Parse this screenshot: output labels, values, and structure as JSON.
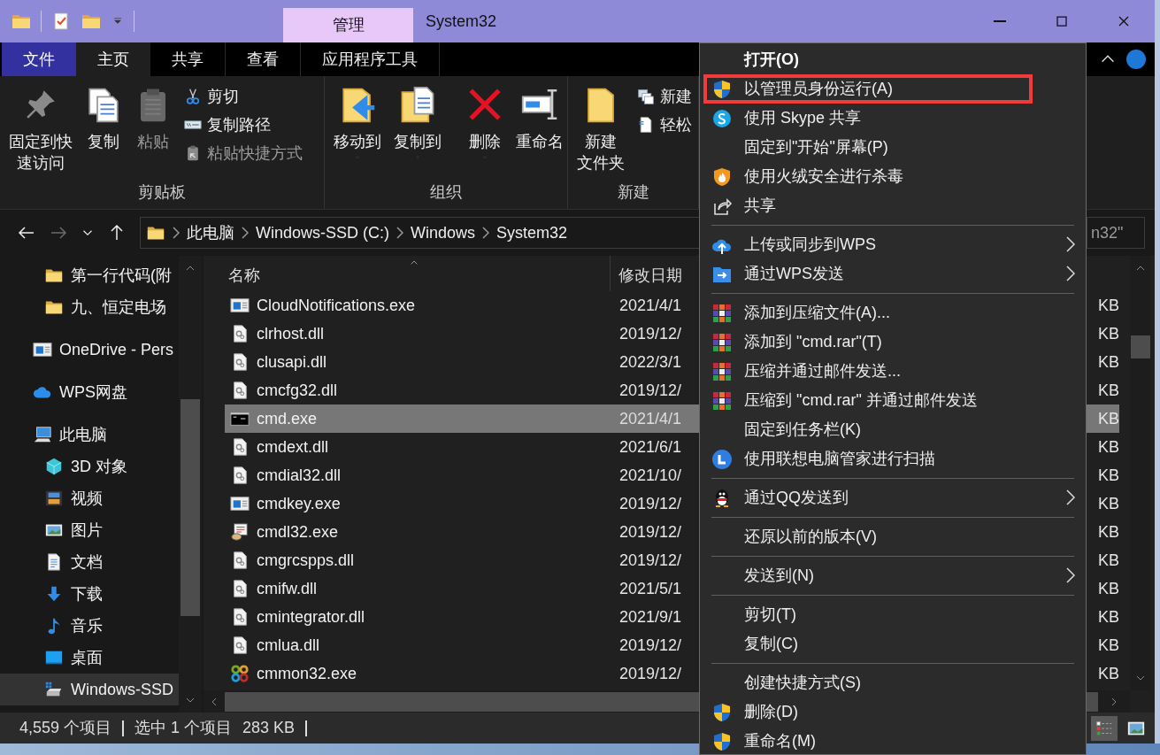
{
  "title_bar": {
    "quick_access": [
      {
        "kind": "folder"
      },
      {
        "kind": "properties"
      },
      {
        "kind": "new-folder"
      },
      {
        "kind": "dropdown"
      }
    ],
    "context_tab": "管理",
    "title": "System32"
  },
  "ribbon": {
    "tabs": [
      {
        "label": "文件",
        "kind": "file",
        "selected": false
      },
      {
        "label": "主页",
        "kind": "tab",
        "selected": true
      },
      {
        "label": "共享",
        "kind": "tab",
        "selected": false
      },
      {
        "label": "查看",
        "kind": "tab",
        "selected": false
      },
      {
        "label": "应用程序工具",
        "kind": "tab",
        "selected": false
      }
    ],
    "groups": [
      {
        "label": "剪贴板",
        "large": [
          {
            "lines": [
              "固定到快",
              "速访问"
            ],
            "kind": "pin",
            "disabled": false,
            "dropdown": false
          },
          {
            "lines": [
              "复制"
            ],
            "kind": "copy",
            "disabled": false,
            "dropdown": false
          },
          {
            "lines": [
              "粘贴"
            ],
            "kind": "paste",
            "disabled": true,
            "dropdown": false
          }
        ],
        "small": [
          {
            "label": "剪切",
            "kind": "cut",
            "disabled": false
          },
          {
            "label": "复制路径",
            "kind": "copy-path",
            "disabled": false
          },
          {
            "label": "粘贴快捷方式",
            "kind": "paste-shortcut",
            "disabled": true
          }
        ]
      },
      {
        "label": "组织",
        "large": [
          {
            "lines": [
              "移动到"
            ],
            "kind": "move-to",
            "disabled": false,
            "dropdown": true
          },
          {
            "lines": [
              "复制到"
            ],
            "kind": "copy-to",
            "disabled": false,
            "dropdown": true
          },
          {
            "kind": "separator"
          },
          {
            "lines": [
              "删除"
            ],
            "kind": "delete",
            "disabled": false,
            "dropdown": true
          },
          {
            "lines": [
              "重命名"
            ],
            "kind": "rename",
            "disabled": false,
            "dropdown": false
          }
        ]
      },
      {
        "label": "新建",
        "large": [
          {
            "lines": [
              "新建",
              "文件夹"
            ],
            "kind": "new-folder",
            "disabled": false,
            "dropdown": false
          }
        ],
        "small": [
          {
            "label": "新建",
            "kind": "new-item",
            "disabled": false
          },
          {
            "label": "轻松",
            "kind": "easy-access",
            "disabled": false
          }
        ]
      }
    ]
  },
  "address_bar": {
    "forward_disabled": true,
    "crumbs": [
      "此电脑",
      "Windows-SSD (C:)",
      "Windows",
      "System32"
    ],
    "search_value": "n32\""
  },
  "navigation": {
    "quick_access_items": [
      {
        "label": "第一行代码(附",
        "kind": "folder",
        "selected": false
      },
      {
        "label": "九、恒定电场",
        "kind": "folder",
        "selected": false
      }
    ],
    "items": [
      {
        "label": "OneDrive - Pers",
        "kind": "app",
        "selected": false
      },
      {
        "label": "WPS网盘",
        "kind": "cloud",
        "selected": false
      },
      {
        "label": "此电脑",
        "kind": "pc",
        "selected": false,
        "children": [
          {
            "label": "3D 对象",
            "kind": "cube",
            "selected": false
          },
          {
            "label": "视频",
            "kind": "video",
            "selected": false
          },
          {
            "label": "图片",
            "kind": "picture",
            "selected": false
          },
          {
            "label": "文档",
            "kind": "document",
            "selected": false
          },
          {
            "label": "下载",
            "kind": "download",
            "selected": false
          },
          {
            "label": "音乐",
            "kind": "music",
            "selected": false
          },
          {
            "label": "桌面",
            "kind": "desktop",
            "selected": false
          },
          {
            "label": "Windows-SSD",
            "kind": "drive",
            "selected": true
          }
        ]
      }
    ]
  },
  "file_list": {
    "columns": [
      "名称",
      "修改日期"
    ],
    "rows": [
      {
        "name": "CloudNotifications.exe",
        "kind": "app",
        "date": "2021/4/1",
        "size": "KB",
        "selected": false
      },
      {
        "name": "clrhost.dll",
        "kind": "dll",
        "date": "2019/12/",
        "size": "KB",
        "selected": false
      },
      {
        "name": "clusapi.dll",
        "kind": "dll",
        "date": "2022/3/1",
        "size": "KB",
        "selected": false
      },
      {
        "name": "cmcfg32.dll",
        "kind": "dll",
        "date": "2019/12/",
        "size": "KB",
        "selected": false
      },
      {
        "name": "cmd.exe",
        "kind": "console",
        "date": "2021/4/1",
        "size": "KB",
        "selected": true
      },
      {
        "name": "cmdext.dll",
        "kind": "dll",
        "date": "2021/6/1",
        "size": "KB",
        "selected": false
      },
      {
        "name": "cmdial32.dll",
        "kind": "dll",
        "date": "2021/10/",
        "size": "KB",
        "selected": false
      },
      {
        "name": "cmdkey.exe",
        "kind": "app",
        "date": "2019/12/",
        "size": "KB",
        "selected": false
      },
      {
        "name": "cmdl32.exe",
        "kind": "phonebook",
        "date": "2019/12/",
        "size": "KB",
        "selected": false
      },
      {
        "name": "cmgrcspps.dll",
        "kind": "dll",
        "date": "2019/12/",
        "size": "KB",
        "selected": false
      },
      {
        "name": "cmifw.dll",
        "kind": "dll",
        "date": "2021/5/1",
        "size": "KB",
        "selected": false
      },
      {
        "name": "cmintegrator.dll",
        "kind": "dll",
        "date": "2021/9/1",
        "size": "KB",
        "selected": false
      },
      {
        "name": "cmlua.dll",
        "kind": "dll",
        "date": "2019/12/",
        "size": "KB",
        "selected": false
      },
      {
        "name": "cmmon32.exe",
        "kind": "cmmon",
        "date": "2019/12/",
        "size": "KB",
        "selected": false
      }
    ]
  },
  "status_bar": {
    "items": [
      "4,559 个项目",
      "选中 1 个项目",
      "283 KB"
    ],
    "view_buttons": [
      {
        "kind": "details",
        "selected": true
      },
      {
        "kind": "thumbnails",
        "selected": false
      }
    ]
  },
  "context_menu": {
    "items": [
      {
        "kind": "plain",
        "label": "打开(O)",
        "default": true,
        "submenu": false,
        "highlight": false
      },
      {
        "kind": "uac",
        "label": "以管理员身份运行(A)",
        "default": false,
        "submenu": false,
        "highlight": true
      },
      {
        "kind": "skype",
        "label": "使用 Skype 共享",
        "default": false,
        "submenu": false,
        "highlight": false
      },
      {
        "kind": "plain",
        "label": "固定到\"开始\"屏幕(P)",
        "default": false,
        "submenu": false,
        "highlight": false
      },
      {
        "kind": "huorong",
        "label": "使用火绒安全进行杀毒",
        "default": false,
        "submenu": false,
        "highlight": false
      },
      {
        "kind": "share",
        "label": "共享",
        "default": false,
        "submenu": false,
        "highlight": false
      },
      {
        "kind": "separator"
      },
      {
        "kind": "upload",
        "label": "上传或同步到WPS",
        "default": false,
        "submenu": true,
        "highlight": false
      },
      {
        "kind": "send",
        "label": "通过WPS发送",
        "default": false,
        "submenu": true,
        "highlight": false
      },
      {
        "kind": "separator"
      },
      {
        "kind": "archive",
        "label": "添加到压缩文件(A)...",
        "default": false,
        "submenu": false,
        "highlight": false
      },
      {
        "kind": "archive",
        "label": "添加到 \"cmd.rar\"(T)",
        "default": false,
        "submenu": false,
        "highlight": false
      },
      {
        "kind": "archive",
        "label": "压缩并通过邮件发送...",
        "default": false,
        "submenu": false,
        "highlight": false
      },
      {
        "kind": "archive",
        "label": "压缩到 \"cmd.rar\" 并通过邮件发送",
        "default": false,
        "submenu": false,
        "highlight": false
      },
      {
        "kind": "plain",
        "label": "固定到任务栏(K)",
        "default": false,
        "submenu": false,
        "highlight": false
      },
      {
        "kind": "lenovo",
        "label": "使用联想电脑管家进行扫描",
        "default": false,
        "submenu": false,
        "highlight": false
      },
      {
        "kind": "separator"
      },
      {
        "kind": "qq",
        "label": "通过QQ发送到",
        "default": false,
        "submenu": true,
        "highlight": false
      },
      {
        "kind": "separator"
      },
      {
        "kind": "plain",
        "label": "还原以前的版本(V)",
        "default": false,
        "submenu": false,
        "highlight": false
      },
      {
        "kind": "separator"
      },
      {
        "kind": "plain",
        "label": "发送到(N)",
        "default": false,
        "submenu": true,
        "highlight": false
      },
      {
        "kind": "separator"
      },
      {
        "kind": "plain",
        "label": "剪切(T)",
        "default": false,
        "submenu": false,
        "highlight": false
      },
      {
        "kind": "plain",
        "label": "复制(C)",
        "default": false,
        "submenu": false,
        "highlight": false
      },
      {
        "kind": "separator"
      },
      {
        "kind": "plain",
        "label": "创建快捷方式(S)",
        "default": false,
        "submenu": false,
        "highlight": false
      },
      {
        "kind": "uac",
        "label": "删除(D)",
        "default": false,
        "submenu": false,
        "highlight": false
      },
      {
        "kind": "uac",
        "label": "重命名(M)",
        "default": false,
        "submenu": false,
        "highlight": false
      }
    ]
  }
}
